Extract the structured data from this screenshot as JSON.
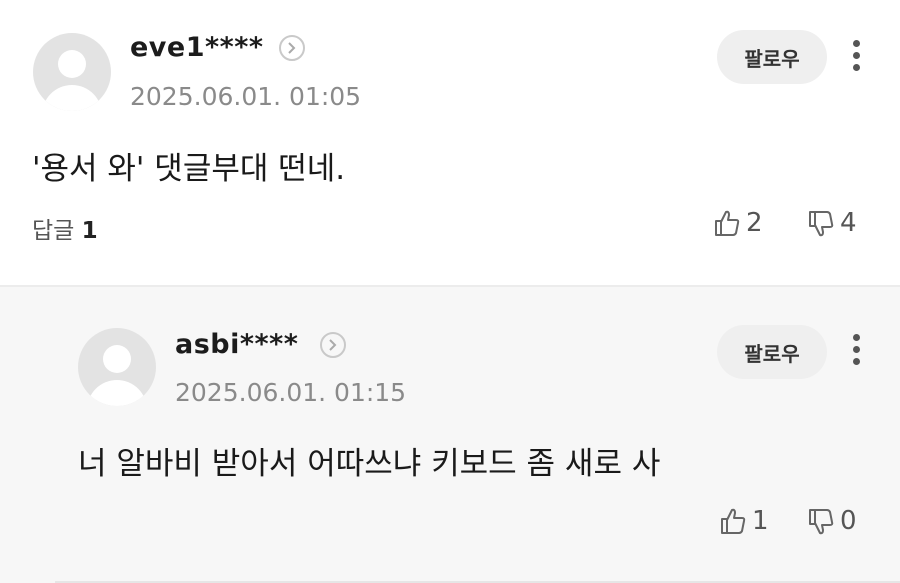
{
  "comments": [
    {
      "username": "eve1****",
      "timestamp": "2025.06.01. 01:05",
      "follow_label": "팔로우",
      "text": "'용서 와' 댓글부대 떤네.",
      "reply_label": "답글",
      "reply_count": "1",
      "likes": "2",
      "dislikes": "4"
    },
    {
      "username": "asbi****",
      "timestamp": "2025.06.01. 01:15",
      "follow_label": "팔로우",
      "text": "너 알바비 받아서 어따쓰냐 키보드 좀 새로 사",
      "likes": "1",
      "dislikes": "0"
    }
  ],
  "icons": {
    "avatar": "default-user-avatar",
    "profile_link": "chevron-right-circle-icon",
    "more": "vertical-ellipsis-icon",
    "like": "thumbs-up-icon",
    "dislike": "thumbs-down-icon"
  }
}
